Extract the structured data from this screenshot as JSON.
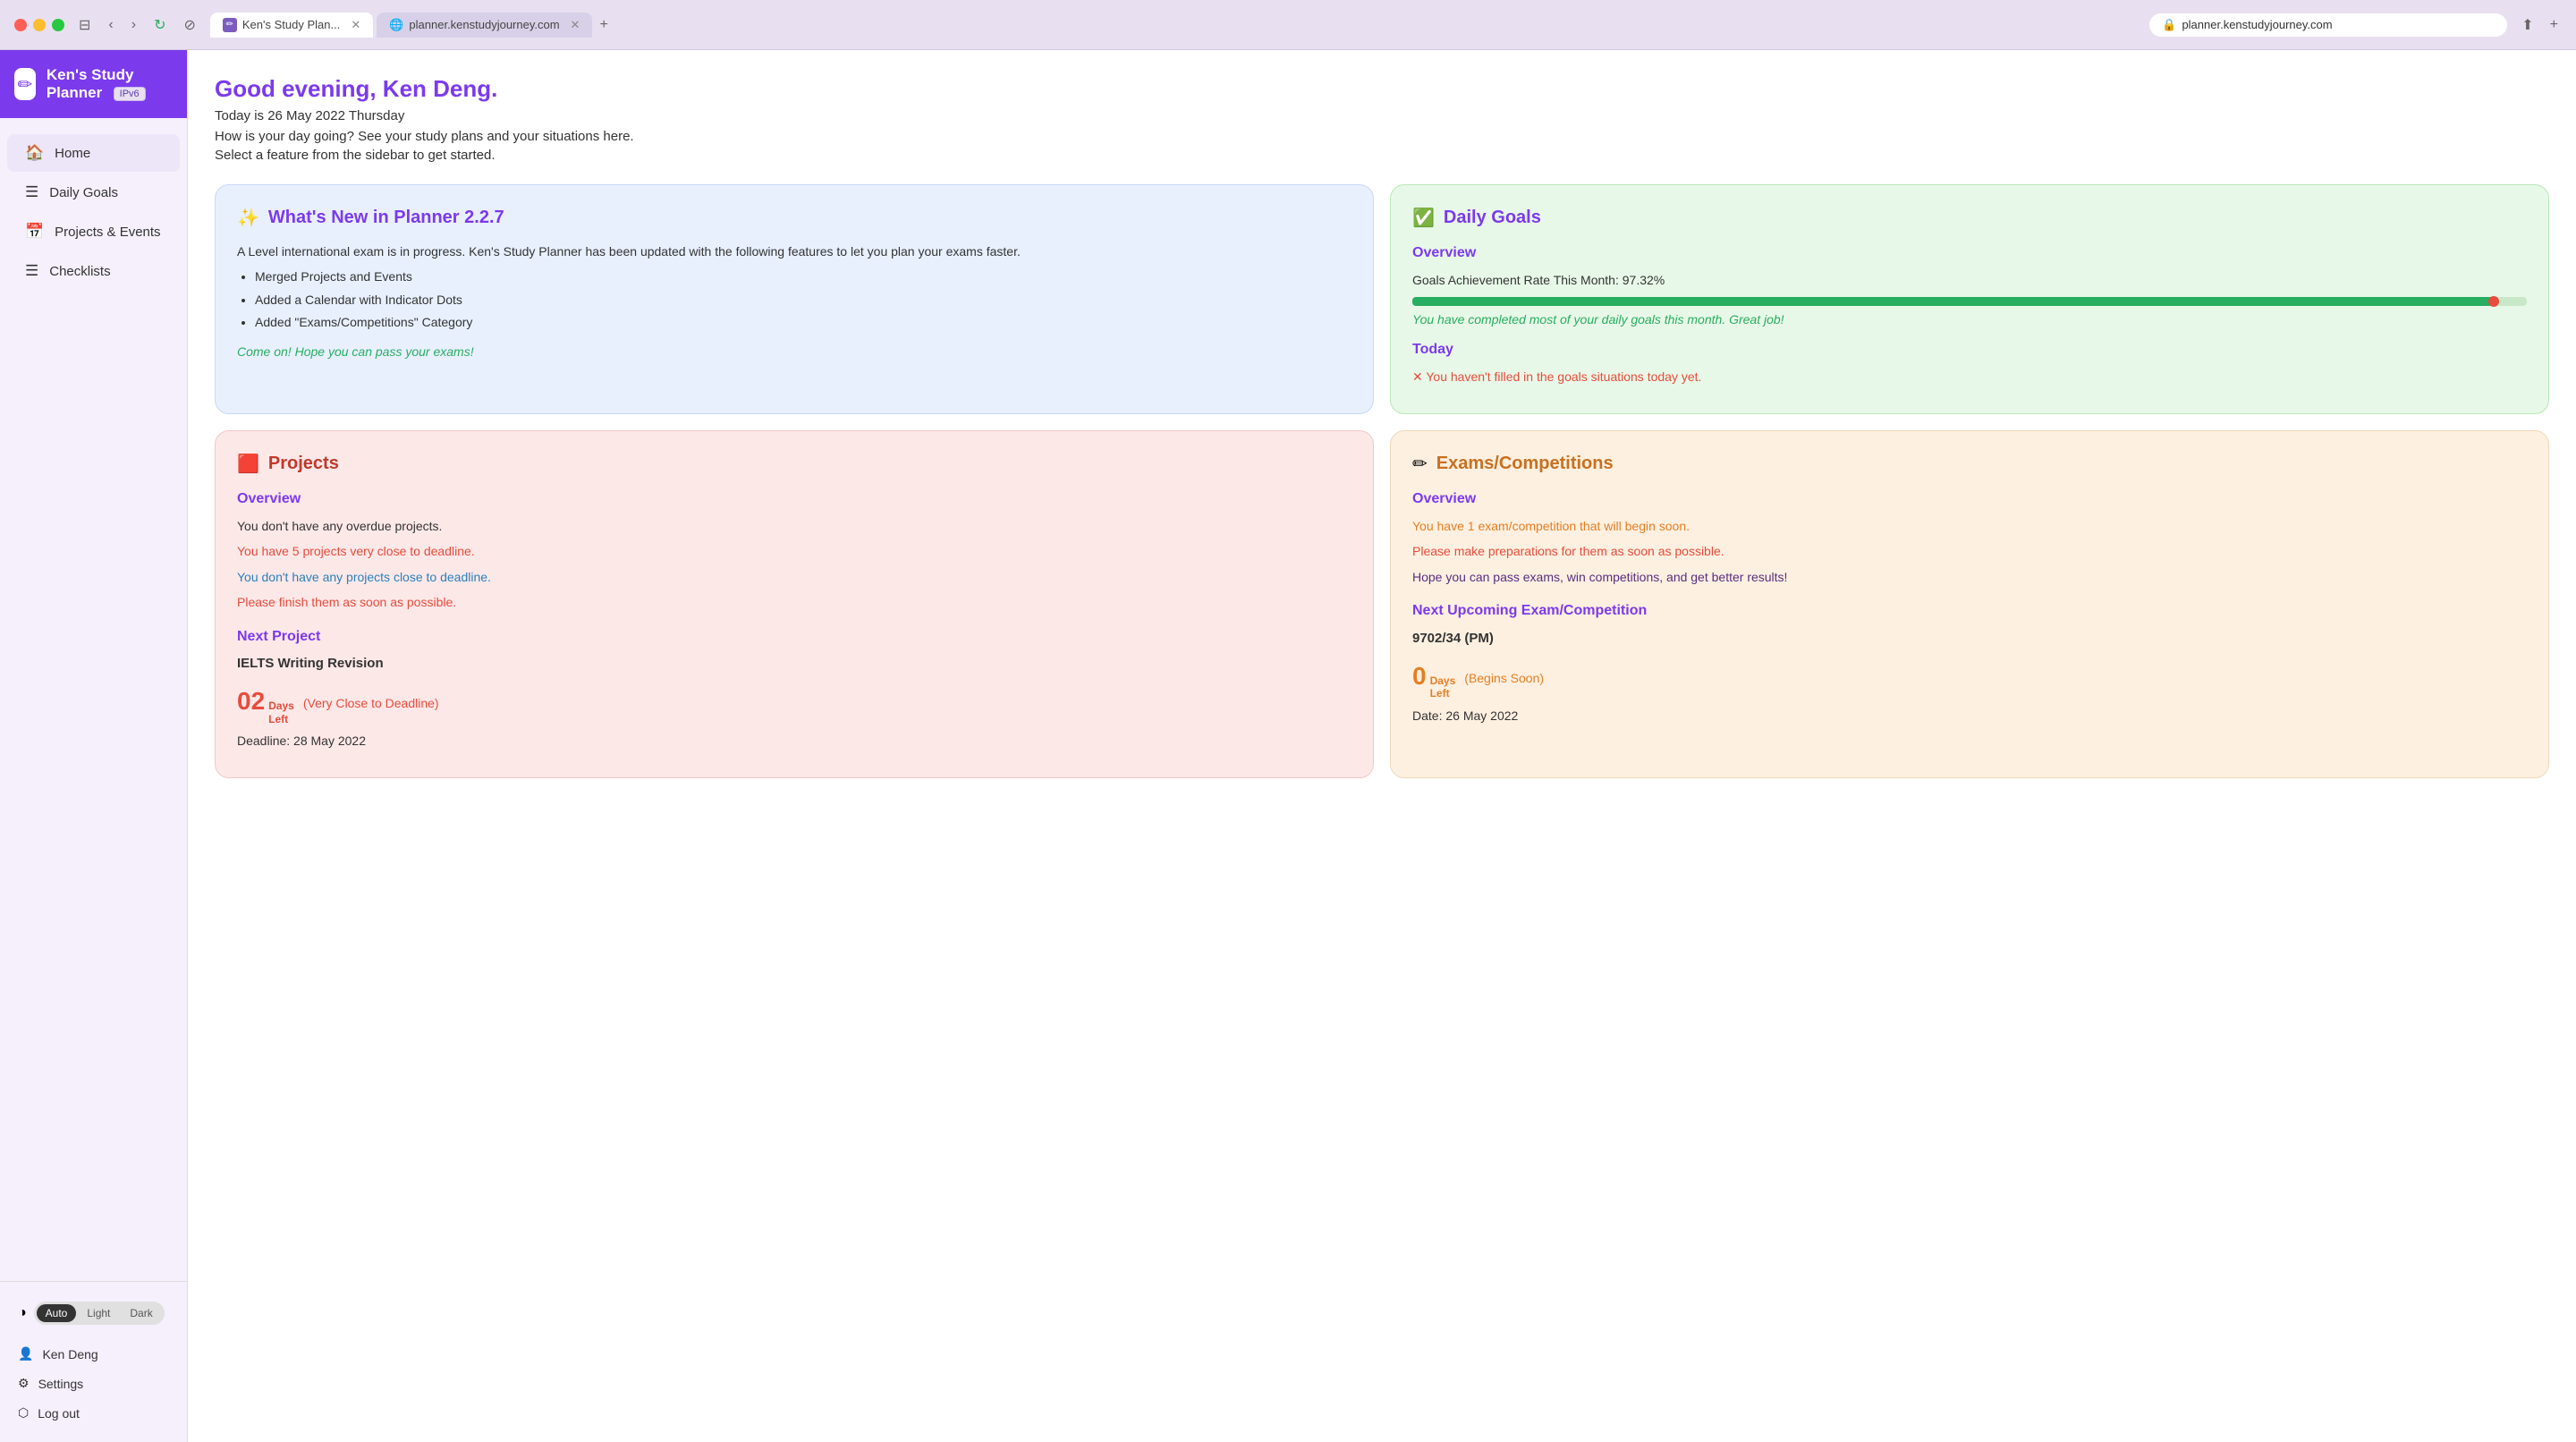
{
  "browser": {
    "tab1_label": "Ken's Study Plan...",
    "tab2_label": "planner.kenstudyjourney.com",
    "address": "planner.kenstudyjourney.com"
  },
  "app": {
    "title": "Ken's Study Planner",
    "ipv6_badge": "IPv6",
    "logo_icon": "✏"
  },
  "sidebar": {
    "nav_items": [
      {
        "label": "Home",
        "icon": "🏠",
        "id": "home",
        "active": true
      },
      {
        "label": "Daily Goals",
        "icon": "☰",
        "id": "daily-goals"
      },
      {
        "label": "Projects & Events",
        "icon": "📅",
        "id": "projects"
      },
      {
        "label": "Checklists",
        "icon": "☰",
        "id": "checklists"
      }
    ],
    "theme": {
      "options": [
        "Auto",
        "Light",
        "Dark"
      ],
      "active": "Auto"
    },
    "user": "Ken Deng",
    "settings_label": "Settings",
    "logout_label": "Log out"
  },
  "main": {
    "greeting": "Good evening, Ken Deng.",
    "date_line": "Today is 26 May 2022 Thursday",
    "how_day": "How is your day going? See your study plans and your situations here.",
    "select_feature": "Select a feature from the sidebar to get started.",
    "whats_new": {
      "title": "What's New in Planner 2.2.7",
      "body": "A Level international exam is in progress. Ken's Study Planner has been updated with the following features to let you plan your exams faster.",
      "bullets": [
        "Merged Projects and Events",
        "Added a Calendar with Indicator Dots",
        "Added \"Exams/Competitions\" Category"
      ],
      "cta": "Come on! Hope you can pass your exams!"
    },
    "daily_goals": {
      "title": "Daily Goals",
      "overview_label": "Overview",
      "achievement_label": "Goals Achievement Rate This Month:",
      "achievement_value": "97.32%",
      "progress_percent": 97.32,
      "achievement_message": "You have completed most of your daily goals this month. Great job!",
      "today_label": "Today",
      "today_message": "✕ You haven't filled in the goals situations today yet."
    },
    "projects": {
      "title": "Projects",
      "overview_label": "Overview",
      "no_overdue": "You don't have any overdue projects.",
      "close_deadline_warning": "You have 5 projects very close to deadline.",
      "no_close_deadline": "You don't have any projects close to deadline.",
      "finish_soon": "Please finish them as soon as possible.",
      "next_project_label": "Next Project",
      "project_name": "IELTS Writing Revision",
      "days_num": "02",
      "days_left_label1": "Days",
      "days_left_label2": "Left",
      "very_close_label": "(Very Close to Deadline)",
      "deadline_label": "Deadline: 28 May 2022"
    },
    "exams": {
      "title": "Exams/Competitions",
      "overview_label": "Overview",
      "begins_soon_msg": "You have 1 exam/competition that will begin soon.",
      "prepare_msg": "Please make preparations for them as soon as possible.",
      "hope_msg": "Hope you can pass exams, win competitions, and get better results!",
      "next_label": "Next Upcoming Exam/Competition",
      "exam_name": "9702/34 (PM)",
      "days_num": "0",
      "days_left_label1": "Days",
      "days_left_label2": "Left",
      "begins_soon_label": "(Begins Soon)",
      "date_label": "Date: 26 May 2022"
    }
  }
}
